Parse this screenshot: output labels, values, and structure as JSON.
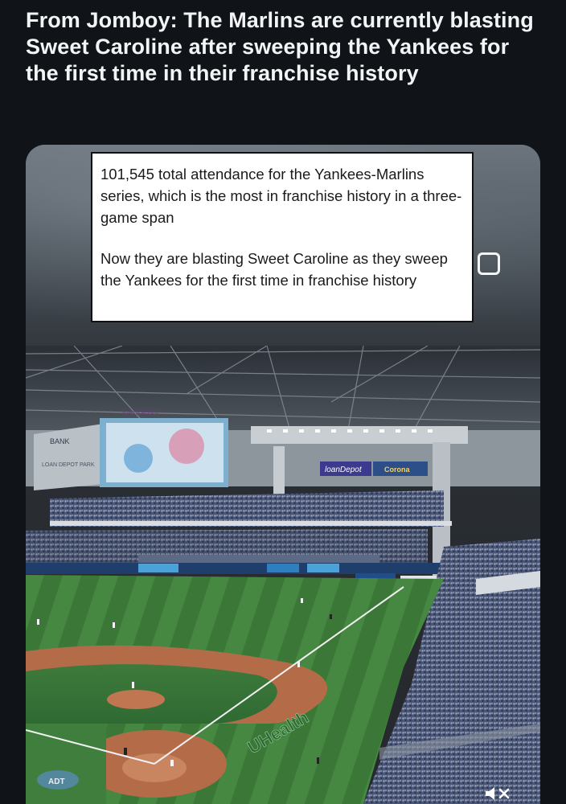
{
  "post": {
    "title": "From Jomboy: The Marlins are currently blasting Sweet Caroline after sweeping the Yankees for the first time in their franchise history"
  },
  "quote": {
    "paragraph_1": "101,545 total attendance for the Yankees-Marlins series, which is the most in franchise history in a three-game span",
    "paragraph_2": "Now they are blasting Sweet Caroline as they sweep the Yankees for the first time in franchise history"
  },
  "stadium_signs": {
    "loandepot": "loanDepot",
    "corona": "Corona",
    "field_logo": "UHealth",
    "adt": "ADT",
    "left_sign": "LOAN DEPOT PARK",
    "bank": "BANK"
  },
  "icons": {
    "select": "square-outline-icon",
    "mute": "speaker-muted-icon"
  },
  "colors": {
    "background": "#101418",
    "title_text": "#f2f4f6",
    "card_bg": "#ffffff",
    "grass": "#3f7a3a",
    "dirt": "#b06a45",
    "seats": "#5c6a88"
  }
}
